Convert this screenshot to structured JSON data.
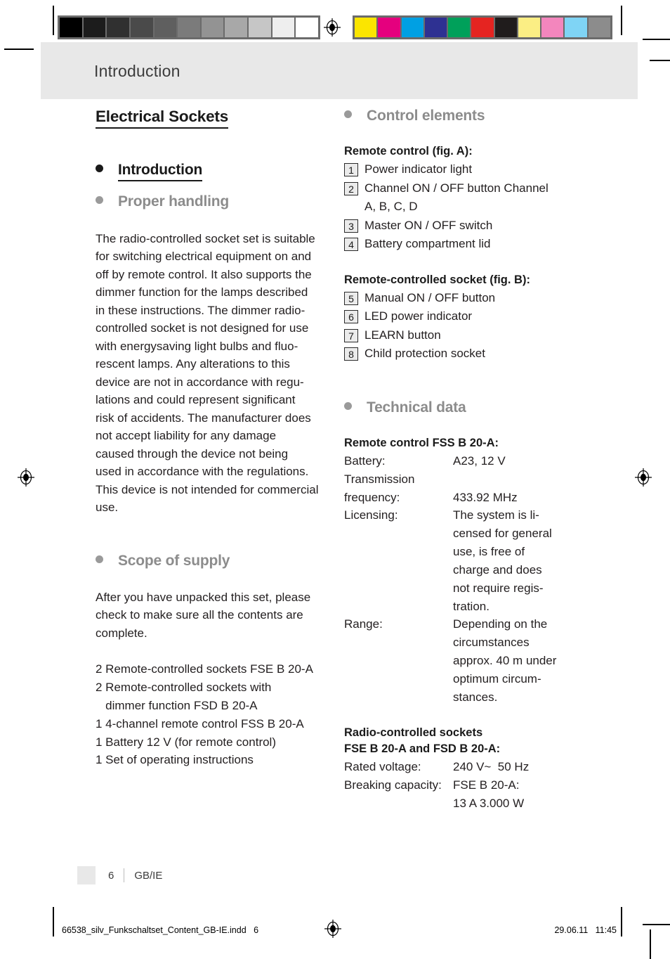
{
  "page": {
    "running_header": "Introduction",
    "footer_page_number": "6",
    "footer_language": "GB/IE",
    "print_footer_file": "66538_silv_Funkschaltset_Content_GB-IE.indd   6",
    "print_footer_date": "29.06.11   11:45"
  },
  "calibration": {
    "gray_swatches": [
      "#000000",
      "#1c1c1c",
      "#303030",
      "#4a4a4a",
      "#5f5f5f",
      "#7b7b7b",
      "#939393",
      "#a8a8a8",
      "#c6c6c6",
      "#eeeeee",
      "#ffffff"
    ],
    "color_swatches": [
      "#fbe500",
      "#e5007e",
      "#00a0e3",
      "#2e3192",
      "#00a05a",
      "#e52421",
      "#201c1c",
      "#fbee84",
      "#f386bd",
      "#7fd4f5",
      "#8c8c8c"
    ]
  },
  "left_column": {
    "title": "Electrical Sockets",
    "heading_introduction": "Introduction",
    "heading_proper_handling": "Proper handling",
    "proper_handling_paragraph": [
      "The radio-controlled socket set is suitable",
      "for switching electrical equipment on and",
      "off by remote control. It also supports the",
      "dimmer function for the lamps described",
      "in these instructions. The dimmer radio-",
      "controlled socket is not designed for use",
      "with energysaving light bulbs and fluo-",
      "rescent lamps. Any alterations to this",
      "device are not in accordance with regu-",
      "lations and could represent significant",
      "risk of accidents. The manufacturer does",
      "not accept liability for any damage",
      "caused through the device not being",
      "used in accordance with the regulations.",
      "This device is not intended for commercial",
      "use."
    ],
    "heading_scope_of_supply": "Scope of supply",
    "scope_paragraph": [
      "After you have unpacked this set, please",
      "check to make sure all the contents are",
      "complete."
    ],
    "scope_items": [
      "2 Remote-controlled sockets FSE B 20-A",
      "2 Remote-controlled sockets with",
      "   dimmer function FSD B 20-A",
      "1 4-channel remote control FSS B 20-A",
      "1 Battery 12 V (for remote control)",
      "1 Set of operating instructions"
    ]
  },
  "right_column": {
    "heading_control_elements": "Control elements",
    "remote_control_subheading": "Remote control (fig. A):",
    "remote_control_items": [
      {
        "num": "1",
        "lines": [
          "Power indicator light"
        ]
      },
      {
        "num": "2",
        "lines": [
          "Channel ON / OFF button Channel",
          "A, B, C, D"
        ]
      },
      {
        "num": "3",
        "lines": [
          "Master ON / OFF switch"
        ]
      },
      {
        "num": "4",
        "lines": [
          "Battery compartment lid"
        ]
      }
    ],
    "socket_subheading": "Remote-controlled socket (fig. B):",
    "socket_items": [
      {
        "num": "5",
        "lines": [
          "Manual ON / OFF button"
        ]
      },
      {
        "num": "6",
        "lines": [
          "LED power indicator"
        ]
      },
      {
        "num": "7",
        "lines": [
          "LEARN button"
        ]
      },
      {
        "num": "8",
        "lines": [
          "Child protection socket"
        ]
      }
    ],
    "heading_technical_data": "Technical data",
    "remote_spec_title": "Remote control FSS B 20-A:",
    "remote_specs": [
      {
        "key": "Battery:",
        "values": [
          "A23, 12 V"
        ]
      },
      {
        "key": "Transmission",
        "values": [
          ""
        ]
      },
      {
        "key": "frequency:",
        "values": [
          "433.92 MHz"
        ]
      },
      {
        "key": "Licensing:",
        "values": [
          "The system is li-",
          "censed for general",
          "use, is free of",
          "charge and does",
          "not require regis-",
          "tration."
        ]
      },
      {
        "key": "Range:",
        "values": [
          "Depending on the",
          "circumstances",
          "approx. 40 m under",
          "optimum circum-",
          "stances."
        ]
      }
    ],
    "sockets_spec_title_line1": "Radio-controlled sockets",
    "sockets_spec_title_line2": "FSE B 20-A and FSD B 20-A:",
    "sockets_specs": [
      {
        "key": "Rated voltage:",
        "values": [
          "240 V~  50 Hz"
        ]
      },
      {
        "key": "Breaking capacity:",
        "values": [
          "FSE B 20-A:",
          "13 A 3.000 W"
        ]
      }
    ]
  }
}
